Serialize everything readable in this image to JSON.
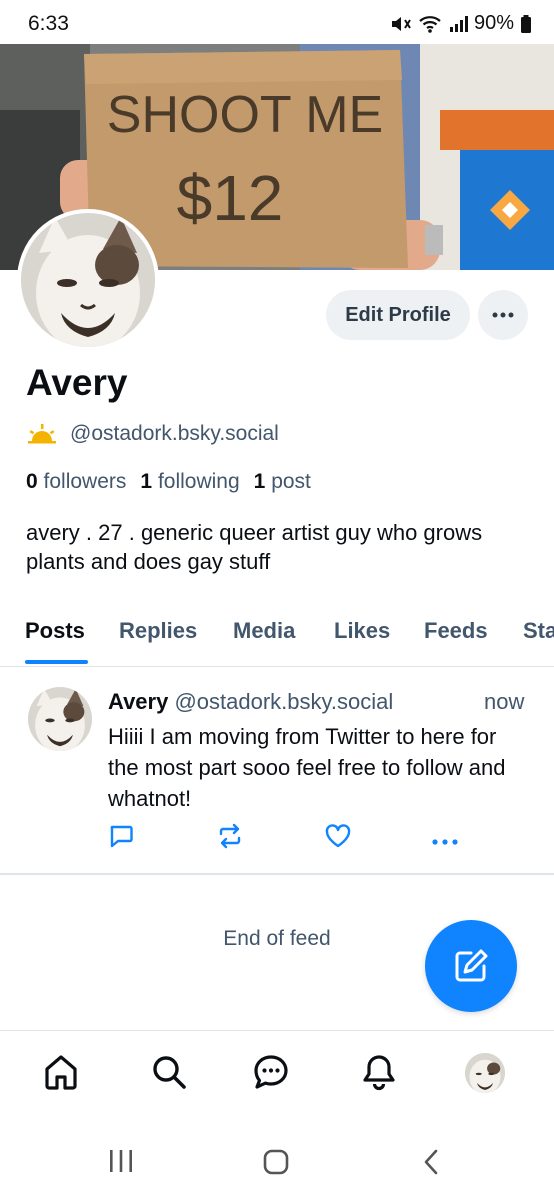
{
  "status_bar": {
    "time": "6:33",
    "battery": "90%",
    "icons": [
      "mute-icon",
      "wifi-icon",
      "signal-icon",
      "battery-icon"
    ]
  },
  "banner": {
    "sign_line1": "SHOOT ME",
    "sign_line2": "$12"
  },
  "profile": {
    "edit_button": "Edit Profile",
    "display_name": "Avery",
    "handle": "@ostadork.bsky.social",
    "followers_count": "0",
    "followers_label": "followers",
    "following_count": "1",
    "following_label": "following",
    "posts_count": "1",
    "posts_label": "post",
    "bio": "avery . 27 .  generic queer artist guy who grows plants and does gay stuff"
  },
  "tabs": [
    {
      "label": "Posts",
      "active": true
    },
    {
      "label": "Replies",
      "active": false
    },
    {
      "label": "Media",
      "active": false
    },
    {
      "label": "Likes",
      "active": false
    },
    {
      "label": "Feeds",
      "active": false
    },
    {
      "label": "Sta",
      "active": false
    }
  ],
  "post": {
    "author_name": "Avery",
    "author_handle": "@ostadork.bsky.social",
    "time": "now",
    "text": "Hiiii I am moving from Twitter to here for the most part sooo feel free to follow and whatnot!"
  },
  "feed": {
    "end_label": "End of feed"
  },
  "colors": {
    "accent": "#1083fe",
    "text_primary": "#0b0f14",
    "text_secondary": "#42566c",
    "button_bg": "#eef1f4",
    "divider": "#dfe4ea"
  }
}
